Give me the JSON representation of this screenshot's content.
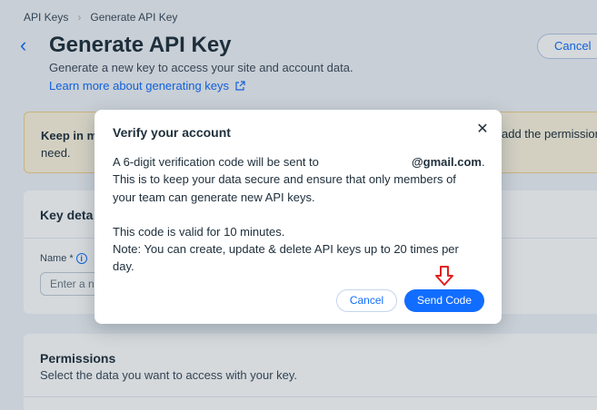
{
  "breadcrumb": {
    "items": [
      "API Keys",
      "Generate API Key"
    ]
  },
  "header": {
    "title": "Generate API Key",
    "subtitle": "Generate a new key to access your site and account data.",
    "learn_link": "Learn more about generating keys",
    "cancel_label": "Cancel"
  },
  "notice": {
    "lead": "Keep in m",
    "line2": "need.",
    "right": "add the permissions"
  },
  "key_details": {
    "title": "Key deta",
    "name_label": "Name",
    "name_required": "*",
    "name_placeholder": "Enter a n"
  },
  "permissions": {
    "title": "Permissions",
    "subtitle": "Select the data you want to access with your key."
  },
  "modal": {
    "title": "Verify your account",
    "line1": "A 6-digit verification code will be sent to",
    "email": "@gmail.com",
    "line1_end": ".",
    "line2": "This is to keep your data secure and ensure that only members of",
    "line3": "your team can generate new API keys.",
    "line4": "This code is valid for 10 minutes.",
    "line5": "Note: You can create, update & delete API keys up to 20 times per",
    "line6": "day.",
    "cancel_label": "Cancel",
    "send_label": "Send Code"
  },
  "colors": {
    "accent": "#116dff",
    "annotation": "#e02020",
    "notice_bg": "#fdf4e0"
  },
  "icons": [
    "chevron-left-icon",
    "external-link-icon",
    "info-icon",
    "close-icon",
    "down-arrow-annotation-icon"
  ]
}
